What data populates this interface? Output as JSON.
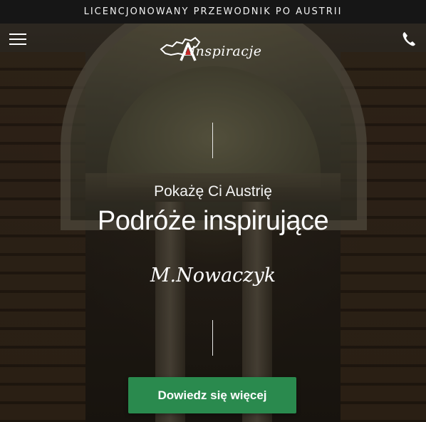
{
  "topbar": {
    "text": "LICENCJONOWANY PRZEWODNIK PO AUSTRII"
  },
  "header": {
    "menu_icon": "hamburger-menu-icon",
    "phone_icon": "phone-icon",
    "logo": {
      "letter": "A",
      "text": "inspiracje"
    }
  },
  "hero": {
    "subtitle": "Pokażę Ci Austrię",
    "headline": "Podróże inspirujące",
    "signature": "M.Nowaczyk",
    "cta_label": "Dowiedz się więcej"
  },
  "colors": {
    "topbar_bg": "#161616",
    "cta_bg": "#2a8a4e",
    "text": "#ffffff"
  }
}
